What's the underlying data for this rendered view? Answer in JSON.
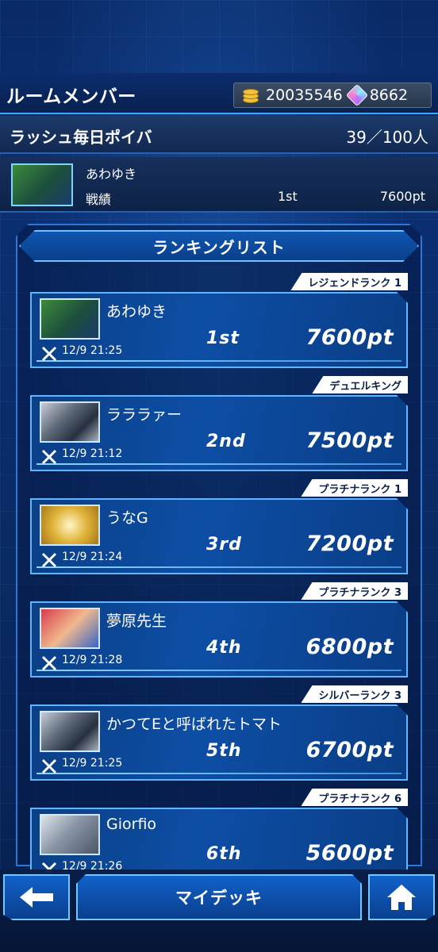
{
  "header": {
    "title": "ルームメンバー",
    "coins": "20035546",
    "gems": "8662"
  },
  "room": {
    "name": "ラッシュ毎日ポイバ",
    "count": "39／100人"
  },
  "self": {
    "name": "あわゆき",
    "label": "戦績",
    "rank": "1st",
    "points": "7600pt"
  },
  "ranking": {
    "title": "ランキングリスト",
    "entries": [
      {
        "badge": "レジェンドランク 1",
        "name": "あわゆき",
        "time": "12/9 21:25",
        "rank": "1st",
        "points": "7600pt",
        "avatar": "green"
      },
      {
        "badge": "デュエルキング",
        "name": "ラララァー",
        "time": "12/9 21:12",
        "rank": "2nd",
        "points": "7500pt",
        "avatar": "dragon"
      },
      {
        "badge": "プラチナランク 1",
        "name": "うなG",
        "time": "12/9 21:24",
        "rank": "3rd",
        "points": "7200pt",
        "avatar": "gold"
      },
      {
        "badge": "プラチナランク 3",
        "name": "夢原先生",
        "time": "12/9 21:28",
        "rank": "4th",
        "points": "6800pt",
        "avatar": "red"
      },
      {
        "badge": "シルバーランク 3",
        "name": "かつてEと呼ばれたトマト",
        "time": "12/9 21:25",
        "rank": "5th",
        "points": "6700pt",
        "avatar": "dragon"
      },
      {
        "badge": "プラチナランク 6",
        "name": "Giorfio",
        "time": "12/9 21:26",
        "rank": "6th",
        "points": "5600pt",
        "avatar": "gray"
      }
    ]
  },
  "nav": {
    "back_icon": "arrow-left-icon",
    "deck_label": "マイデッキ",
    "home_icon": "home-icon"
  }
}
